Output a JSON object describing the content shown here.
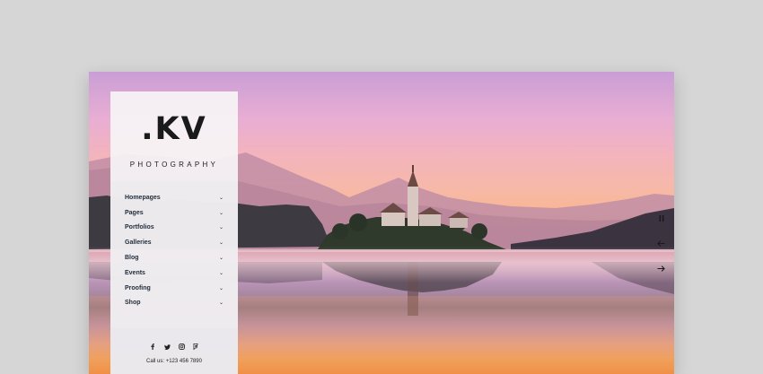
{
  "brand": {
    "logo_text": ".KV",
    "tagline": "PHOTOGRAPHY"
  },
  "menu": {
    "items": [
      {
        "label": "Homepages",
        "icon": "chevron-down-icon"
      },
      {
        "label": "Pages",
        "icon": "chevron-down-icon"
      },
      {
        "label": "Portfolios",
        "icon": "chevron-down-icon"
      },
      {
        "label": "Galleries",
        "icon": "chevron-down-icon"
      },
      {
        "label": "Blog",
        "icon": "chevron-down-icon"
      },
      {
        "label": "Events",
        "icon": "chevron-down-icon"
      },
      {
        "label": "Proofing",
        "icon": "chevron-down-icon"
      },
      {
        "label": "Shop",
        "icon": "chevron-down-icon"
      }
    ]
  },
  "footer": {
    "socials": [
      "facebook-icon",
      "twitter-icon",
      "instagram-icon",
      "foursquare-icon"
    ],
    "contact": "Call us: +123 456 7890"
  },
  "slider_controls": {
    "pause_icon": "pause-icon",
    "prev_icon": "arrow-left-icon",
    "next_icon": "arrow-right-icon"
  },
  "colors": {
    "page_background": "#d6d6d6",
    "sidebar_background": "#f6f4f6",
    "text_dark": "#1f2c3a"
  }
}
